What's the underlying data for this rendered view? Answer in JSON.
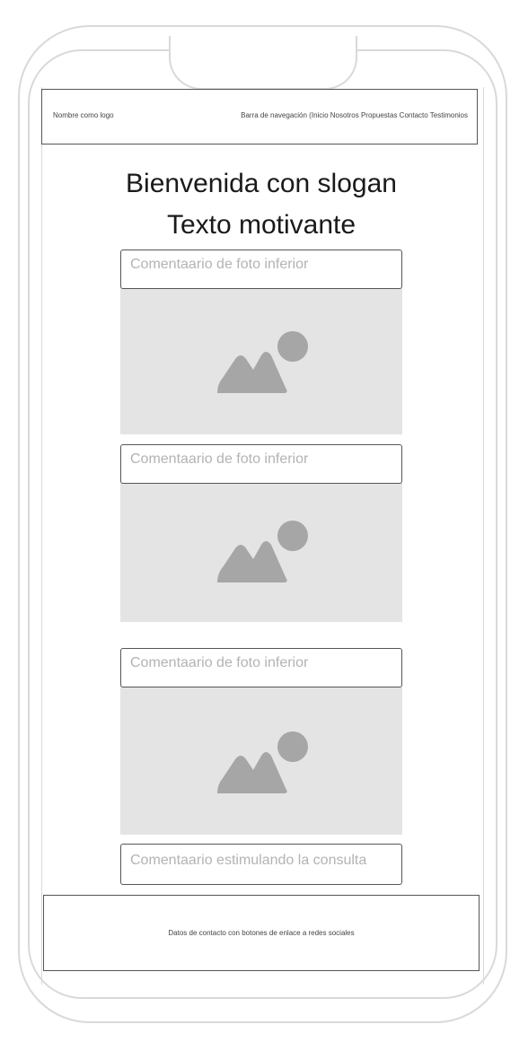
{
  "header": {
    "logo_text": "Nombre como logo",
    "nav_text": "Barra de navegación (Inicio Nosotros Propuestas Contacto Testimonios"
  },
  "hero": {
    "line1": "Bienvenida con slogan",
    "line2": "Texto motivante"
  },
  "photos": [
    {
      "caption": "Comentaario de foto inferior",
      "image_icon": "image-placeholder-icon"
    },
    {
      "caption": "Comentaario de foto inferior",
      "image_icon": "image-placeholder-icon"
    },
    {
      "caption": "Comentaario de foto inferior",
      "image_icon": "image-placeholder-icon"
    }
  ],
  "consult": {
    "text": "Comentaario estimulando la consulta"
  },
  "footer": {
    "text": "Datos de contacto con botones de enlace a redes sociales"
  },
  "colors": {
    "frame": "#d9d9d9",
    "border": "#555555",
    "placeholder_bg": "#e4e4e4",
    "placeholder_icon": "#a6a6a6",
    "caption_text": "#b3b3b3"
  }
}
